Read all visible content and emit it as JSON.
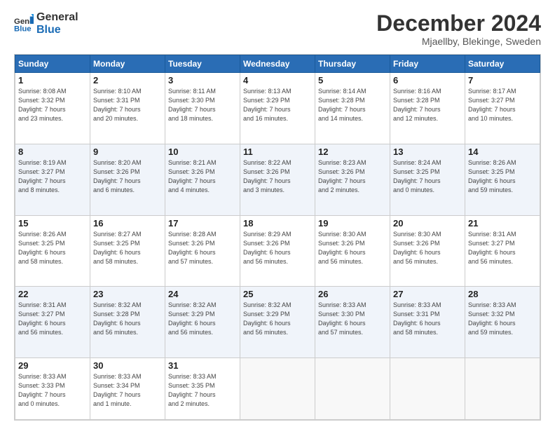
{
  "logo": {
    "line1": "General",
    "line2": "Blue"
  },
  "title": "December 2024",
  "subtitle": "Mjaellby, Blekinge, Sweden",
  "header": {
    "days": [
      "Sunday",
      "Monday",
      "Tuesday",
      "Wednesday",
      "Thursday",
      "Friday",
      "Saturday"
    ]
  },
  "weeks": [
    [
      {
        "day": "1",
        "info": "Sunrise: 8:08 AM\nSunset: 3:32 PM\nDaylight: 7 hours\nand 23 minutes."
      },
      {
        "day": "2",
        "info": "Sunrise: 8:10 AM\nSunset: 3:31 PM\nDaylight: 7 hours\nand 20 minutes."
      },
      {
        "day": "3",
        "info": "Sunrise: 8:11 AM\nSunset: 3:30 PM\nDaylight: 7 hours\nand 18 minutes."
      },
      {
        "day": "4",
        "info": "Sunrise: 8:13 AM\nSunset: 3:29 PM\nDaylight: 7 hours\nand 16 minutes."
      },
      {
        "day": "5",
        "info": "Sunrise: 8:14 AM\nSunset: 3:28 PM\nDaylight: 7 hours\nand 14 minutes."
      },
      {
        "day": "6",
        "info": "Sunrise: 8:16 AM\nSunset: 3:28 PM\nDaylight: 7 hours\nand 12 minutes."
      },
      {
        "day": "7",
        "info": "Sunrise: 8:17 AM\nSunset: 3:27 PM\nDaylight: 7 hours\nand 10 minutes."
      }
    ],
    [
      {
        "day": "8",
        "info": "Sunrise: 8:19 AM\nSunset: 3:27 PM\nDaylight: 7 hours\nand 8 minutes."
      },
      {
        "day": "9",
        "info": "Sunrise: 8:20 AM\nSunset: 3:26 PM\nDaylight: 7 hours\nand 6 minutes."
      },
      {
        "day": "10",
        "info": "Sunrise: 8:21 AM\nSunset: 3:26 PM\nDaylight: 7 hours\nand 4 minutes."
      },
      {
        "day": "11",
        "info": "Sunrise: 8:22 AM\nSunset: 3:26 PM\nDaylight: 7 hours\nand 3 minutes."
      },
      {
        "day": "12",
        "info": "Sunrise: 8:23 AM\nSunset: 3:26 PM\nDaylight: 7 hours\nand 2 minutes."
      },
      {
        "day": "13",
        "info": "Sunrise: 8:24 AM\nSunset: 3:25 PM\nDaylight: 7 hours\nand 0 minutes."
      },
      {
        "day": "14",
        "info": "Sunrise: 8:26 AM\nSunset: 3:25 PM\nDaylight: 6 hours\nand 59 minutes."
      }
    ],
    [
      {
        "day": "15",
        "info": "Sunrise: 8:26 AM\nSunset: 3:25 PM\nDaylight: 6 hours\nand 58 minutes."
      },
      {
        "day": "16",
        "info": "Sunrise: 8:27 AM\nSunset: 3:25 PM\nDaylight: 6 hours\nand 58 minutes."
      },
      {
        "day": "17",
        "info": "Sunrise: 8:28 AM\nSunset: 3:26 PM\nDaylight: 6 hours\nand 57 minutes."
      },
      {
        "day": "18",
        "info": "Sunrise: 8:29 AM\nSunset: 3:26 PM\nDaylight: 6 hours\nand 56 minutes."
      },
      {
        "day": "19",
        "info": "Sunrise: 8:30 AM\nSunset: 3:26 PM\nDaylight: 6 hours\nand 56 minutes."
      },
      {
        "day": "20",
        "info": "Sunrise: 8:30 AM\nSunset: 3:26 PM\nDaylight: 6 hours\nand 56 minutes."
      },
      {
        "day": "21",
        "info": "Sunrise: 8:31 AM\nSunset: 3:27 PM\nDaylight: 6 hours\nand 56 minutes."
      }
    ],
    [
      {
        "day": "22",
        "info": "Sunrise: 8:31 AM\nSunset: 3:27 PM\nDaylight: 6 hours\nand 56 minutes."
      },
      {
        "day": "23",
        "info": "Sunrise: 8:32 AM\nSunset: 3:28 PM\nDaylight: 6 hours\nand 56 minutes."
      },
      {
        "day": "24",
        "info": "Sunrise: 8:32 AM\nSunset: 3:29 PM\nDaylight: 6 hours\nand 56 minutes."
      },
      {
        "day": "25",
        "info": "Sunrise: 8:32 AM\nSunset: 3:29 PM\nDaylight: 6 hours\nand 56 minutes."
      },
      {
        "day": "26",
        "info": "Sunrise: 8:33 AM\nSunset: 3:30 PM\nDaylight: 6 hours\nand 57 minutes."
      },
      {
        "day": "27",
        "info": "Sunrise: 8:33 AM\nSunset: 3:31 PM\nDaylight: 6 hours\nand 58 minutes."
      },
      {
        "day": "28",
        "info": "Sunrise: 8:33 AM\nSunset: 3:32 PM\nDaylight: 6 hours\nand 59 minutes."
      }
    ],
    [
      {
        "day": "29",
        "info": "Sunrise: 8:33 AM\nSunset: 3:33 PM\nDaylight: 7 hours\nand 0 minutes."
      },
      {
        "day": "30",
        "info": "Sunrise: 8:33 AM\nSunset: 3:34 PM\nDaylight: 7 hours\nand 1 minute."
      },
      {
        "day": "31",
        "info": "Sunrise: 8:33 AM\nSunset: 3:35 PM\nDaylight: 7 hours\nand 2 minutes."
      },
      {
        "day": "",
        "info": ""
      },
      {
        "day": "",
        "info": ""
      },
      {
        "day": "",
        "info": ""
      },
      {
        "day": "",
        "info": ""
      }
    ]
  ]
}
